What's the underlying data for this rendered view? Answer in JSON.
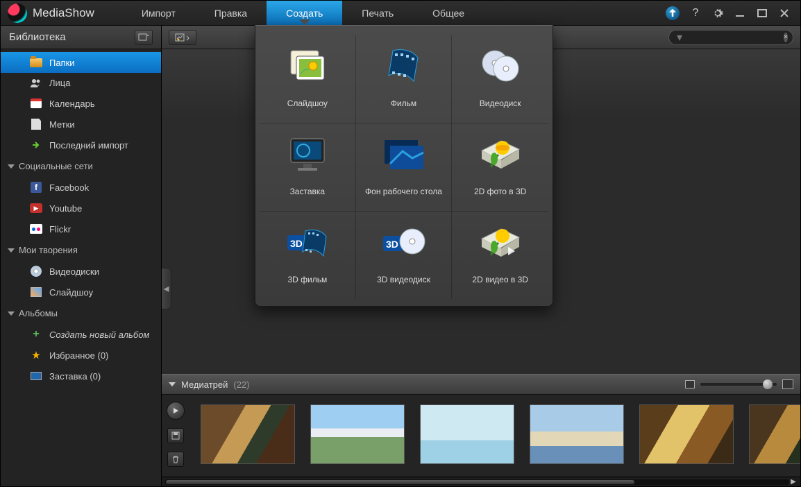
{
  "app": {
    "title": "MediaShow"
  },
  "menu": {
    "items": [
      {
        "label": "Импорт"
      },
      {
        "label": "Правка"
      },
      {
        "label": "Создать",
        "active": true
      },
      {
        "label": "Печать"
      },
      {
        "label": "Общее"
      }
    ]
  },
  "sidebar": {
    "header": "Библиотека",
    "lib": [
      {
        "label": "Папки",
        "icon": "folder",
        "active": true
      },
      {
        "label": "Лица",
        "icon": "people"
      },
      {
        "label": "Календарь",
        "icon": "calendar"
      },
      {
        "label": "Метки",
        "icon": "tags"
      },
      {
        "label": "Последний импорт",
        "icon": "import"
      }
    ],
    "groups": {
      "social": {
        "title": "Социальные сети",
        "items": [
          {
            "label": "Facebook",
            "icon": "facebook"
          },
          {
            "label": "Youtube",
            "icon": "youtube"
          },
          {
            "label": "Flickr",
            "icon": "flickr"
          }
        ]
      },
      "creations": {
        "title": "Мои творения",
        "items": [
          {
            "label": "Видеодиски",
            "icon": "disc"
          },
          {
            "label": "Слайдшоу",
            "icon": "slideshow"
          }
        ]
      },
      "albums": {
        "title": "Альбомы",
        "items": [
          {
            "label": "Создать новый альбом",
            "icon": "plus",
            "italic": true
          },
          {
            "label": "Избранное (0)",
            "icon": "star"
          },
          {
            "label": "Заставка (0)",
            "icon": "screen"
          }
        ]
      }
    }
  },
  "search": {
    "placeholder": ""
  },
  "panel": {
    "items": [
      {
        "label": "Слайдшоу",
        "icon": "slideshow"
      },
      {
        "label": "Фильм",
        "icon": "film"
      },
      {
        "label": "Видеодиск",
        "icon": "videodisc"
      },
      {
        "label": "Заставка",
        "icon": "screensaver"
      },
      {
        "label": "Фон рабочего стола",
        "icon": "wallpaper"
      },
      {
        "label": "2D фото в 3D",
        "icon": "photo3d"
      },
      {
        "label": "3D фильм",
        "icon": "film3d"
      },
      {
        "label": "3D видеодиск",
        "icon": "disc3d"
      },
      {
        "label": "2D видео в 3D",
        "icon": "video3d"
      }
    ]
  },
  "tray": {
    "title": "Медиатрей",
    "count": "(22)",
    "thumbs": [
      "a",
      "b",
      "c",
      "d",
      "e",
      "f"
    ]
  }
}
